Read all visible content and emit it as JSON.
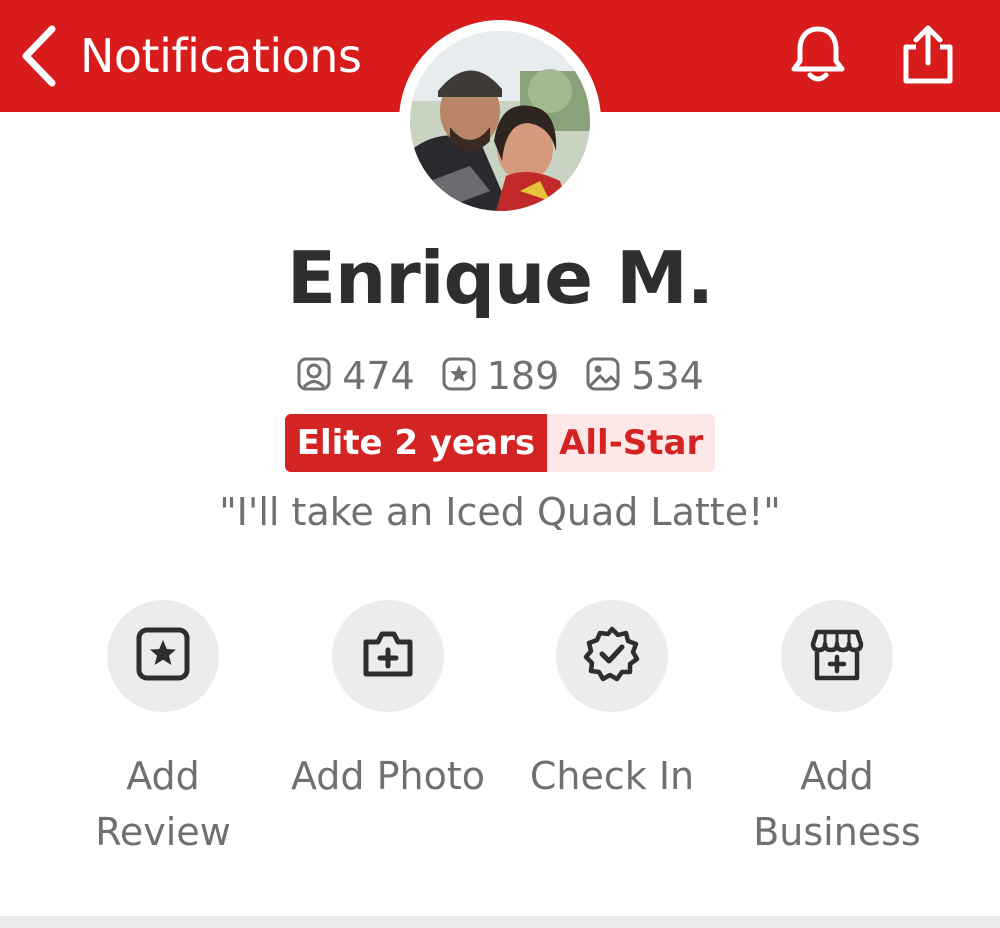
{
  "header": {
    "back_label": "Notifications",
    "background_color": "#d81b1b",
    "icons": [
      "chevron-left-icon",
      "bell-icon",
      "share-icon"
    ]
  },
  "profile": {
    "name": "Enrique M.",
    "stats": {
      "friends": "474",
      "reviews": "189",
      "photos": "534"
    },
    "badges": {
      "elite": "Elite 2 years",
      "allstar": "All-Star"
    },
    "tagline": "\"I'll take an Iced Quad Latte!\""
  },
  "actions": [
    {
      "line1": "Add",
      "line2": "Review",
      "icon": "star-box-icon"
    },
    {
      "line1": "Add Photo",
      "line2": "",
      "icon": "camera-plus-icon"
    },
    {
      "line1": "Check In",
      "line2": "",
      "icon": "verified-badge-icon"
    },
    {
      "line1": "Add",
      "line2": "Business",
      "icon": "storefront-plus-icon"
    }
  ],
  "colors": {
    "accent": "#d32323",
    "text_dark": "#2d2e2f",
    "text_muted": "#6e7072",
    "action_bg": "#ececec"
  }
}
